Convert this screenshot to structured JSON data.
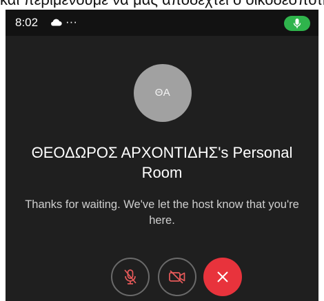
{
  "caption": {
    "text": "και περιμένουμε να μας αποδεχτεί ο οικοδεσπότης"
  },
  "status_bar": {
    "time": "8:02",
    "more_indicator": "···",
    "icons": [
      "cloud-icon",
      "more-icon",
      "microphone-active-icon"
    ],
    "mic_pill_color": "#2fb44c"
  },
  "avatar": {
    "initials": "ΘΑ",
    "color": "#a1a1a1"
  },
  "room": {
    "title": "ΘΕΟΔΩΡΟΣ ΑΡΧΟΝΤΙΔΗΣ's Personal Room"
  },
  "waiting": {
    "message": "Thanks for waiting. We've let the host know that you're here."
  },
  "controls": {
    "mute_icon": "microphone-muted-icon",
    "video_icon": "video-off-icon",
    "leave_icon": "close-icon",
    "muted_icon_color": "#e85a5a",
    "leave_color": "#e8333c"
  },
  "colors": {
    "background": "#1f1f1f",
    "status_bar": "#121212"
  }
}
